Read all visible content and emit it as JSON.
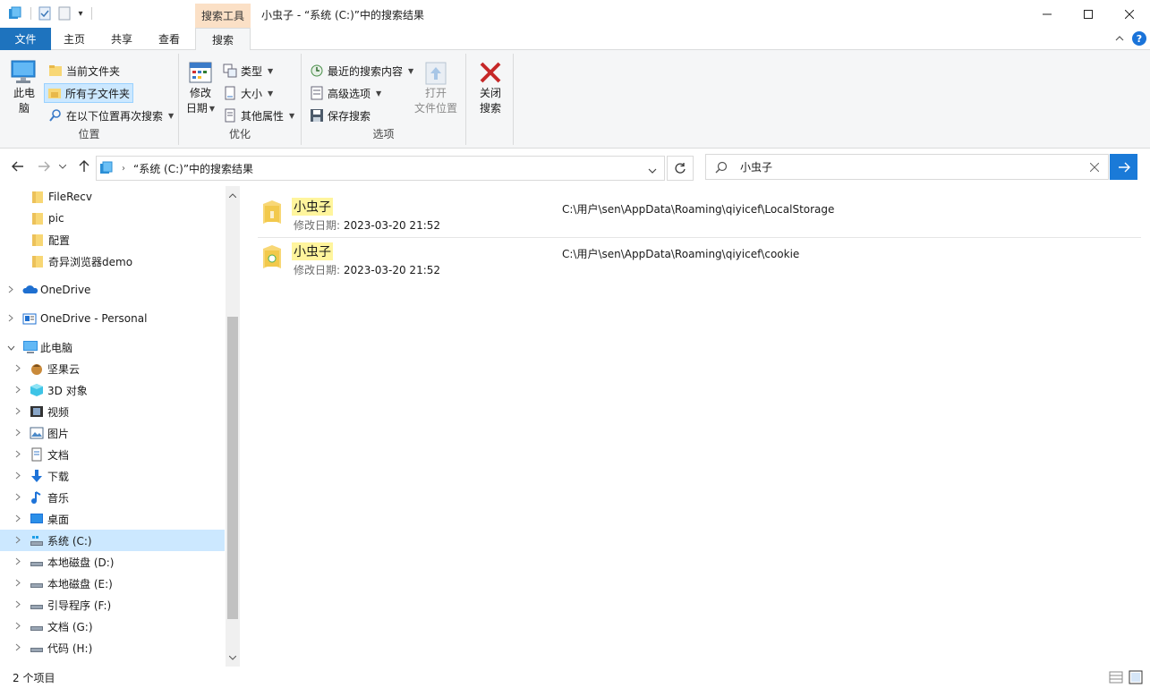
{
  "titlebar": {
    "context_tab": "搜索工具",
    "title": "小虫子 - “系统 (C:)”中的搜索结果",
    "minimize": "—",
    "maximize": "☐",
    "close": "✕"
  },
  "tabs": {
    "file": "文件",
    "home": "主页",
    "share": "共享",
    "view": "查看",
    "search": "搜索"
  },
  "ribbon": {
    "location": {
      "this_pc_line1": "此电",
      "this_pc_line2": "脑",
      "current_folder": "当前文件夹",
      "all_subfolders": "所有子文件夹",
      "search_again": "在以下位置再次搜索",
      "group_label": "位置"
    },
    "refine": {
      "date_modified_line1": "修改",
      "date_modified_line2": "日期",
      "kind": "类型",
      "size": "大小",
      "other_props": "其他属性",
      "group_label": "优化"
    },
    "options": {
      "recent_searches": "最近的搜索内容",
      "advanced_options": "高级选项",
      "save_search": "保存搜索",
      "open_location_line1": "打开",
      "open_location_line2": "文件位置",
      "group_label": "选项"
    },
    "close": {
      "line1": "关闭",
      "line2": "搜索"
    }
  },
  "address": {
    "path": "“系统 (C:)”中的搜索结果",
    "search_value": "小虫子"
  },
  "navpane": {
    "items": [
      {
        "label": "FileRecv",
        "icon": "folder-icon"
      },
      {
        "label": "pic",
        "icon": "folder-icon"
      },
      {
        "label": "配置",
        "icon": "folder-icon"
      },
      {
        "label": "奇异浏览器demo",
        "icon": "folder-icon"
      },
      {
        "label": "OneDrive",
        "icon": "onedrive-icon"
      },
      {
        "label": "OneDrive - Personal",
        "icon": "onedrive-personal-icon"
      },
      {
        "label": "此电脑",
        "icon": "this-pc-icon"
      },
      {
        "label": "坚果云",
        "icon": "nutstore-icon"
      },
      {
        "label": "3D 对象",
        "icon": "3d-objects-icon"
      },
      {
        "label": "视频",
        "icon": "video-icon"
      },
      {
        "label": "图片",
        "icon": "pictures-icon"
      },
      {
        "label": "文档",
        "icon": "documents-icon"
      },
      {
        "label": "下载",
        "icon": "downloads-icon"
      },
      {
        "label": "音乐",
        "icon": "music-icon"
      },
      {
        "label": "桌面",
        "icon": "desktop-icon"
      },
      {
        "label": "系统 (C:)",
        "icon": "system-drive-icon"
      },
      {
        "label": "本地磁盘 (D:)",
        "icon": "drive-icon"
      },
      {
        "label": "本地磁盘 (E:)",
        "icon": "drive-icon"
      },
      {
        "label": "引导程序 (F:)",
        "icon": "drive-icon"
      },
      {
        "label": "文档 (G:)",
        "icon": "drive-icon"
      },
      {
        "label": "代码 (H:)",
        "icon": "drive-icon"
      }
    ]
  },
  "results": [
    {
      "name": "小虫子",
      "meta_label": "修改日期:",
      "meta_value": "2023-03-20 21:52",
      "path": "C:\\用户\\sen\\AppData\\Roaming\\qiyicef\\LocalStorage",
      "icon": "folder-icon"
    },
    {
      "name": "小虫子",
      "meta_label": "修改日期:",
      "meta_value": "2023-03-20 21:52",
      "path": "C:\\用户\\sen\\AppData\\Roaming\\qiyicef\\cookie",
      "icon": "folder-icon"
    }
  ],
  "status": {
    "count": "2 个项目"
  },
  "colors": {
    "accent": "#1e73be",
    "selection": "#cce8ff",
    "highlight": "#fff59d",
    "context_tab": "#fbe0c6"
  }
}
